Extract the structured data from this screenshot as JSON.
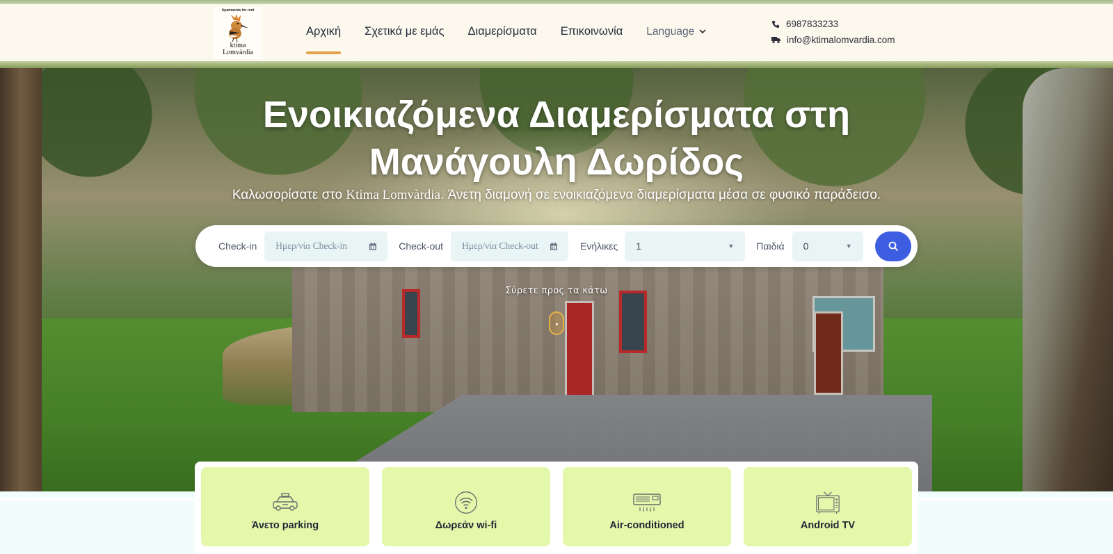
{
  "header": {
    "logo": {
      "tagline": "Apartments for rent",
      "brand_line1": "ktima",
      "brand_line2": "Lomvàrdia"
    },
    "nav": [
      {
        "label": "Αρχική",
        "active": true
      },
      {
        "label": "Σχετικά με εμάς",
        "active": false
      },
      {
        "label": "Διαμερίσματα",
        "active": false
      },
      {
        "label": "Επικοινωνία",
        "active": false
      }
    ],
    "language_label": "Language",
    "contact": {
      "phone": "6987833233",
      "email": "info@ktimalomvardia.com"
    }
  },
  "hero": {
    "title_line1": "Ενοικιαζόμενα Διαμερίσματα στη",
    "title_line2": "Μανάγουλη Δωρίδος",
    "subtitle_before": "Καλωσορίσατε στο ",
    "subtitle_brand": "Ktima Lomvàrdia",
    "subtitle_after": ". Άνετη διαμονή σε ενοικιαζόμενα διαμερίσματα μέσα σε φυσικό παράδεισο.",
    "scroll_hint": "Σύρετε προς τα κάτω"
  },
  "booking": {
    "checkin_label": "Check-in",
    "checkin_placeholder": "Ημερ/νία Check-in",
    "checkout_label": "Check-out",
    "checkout_placeholder": "Ημερ/νία Check-out",
    "adults_label": "Ενήλικες",
    "adults_value": "1",
    "children_label": "Παιδιά",
    "children_value": "0"
  },
  "amenities": [
    {
      "label": "Άνετο parking",
      "icon": "taxi-icon"
    },
    {
      "label": "Δωρεάν wi-fi",
      "icon": "wifi-icon"
    },
    {
      "label": "Air-conditioned",
      "icon": "air-conditioner-icon"
    },
    {
      "label": "Android TV",
      "icon": "tv-icon"
    }
  ],
  "colors": {
    "accent_underline": "#e3a249",
    "search_button": "#3d5ee0",
    "amenity_card": "#e4f8ac",
    "header_bg": "#fdf8ee",
    "page_bg": "#f1fdfc"
  }
}
